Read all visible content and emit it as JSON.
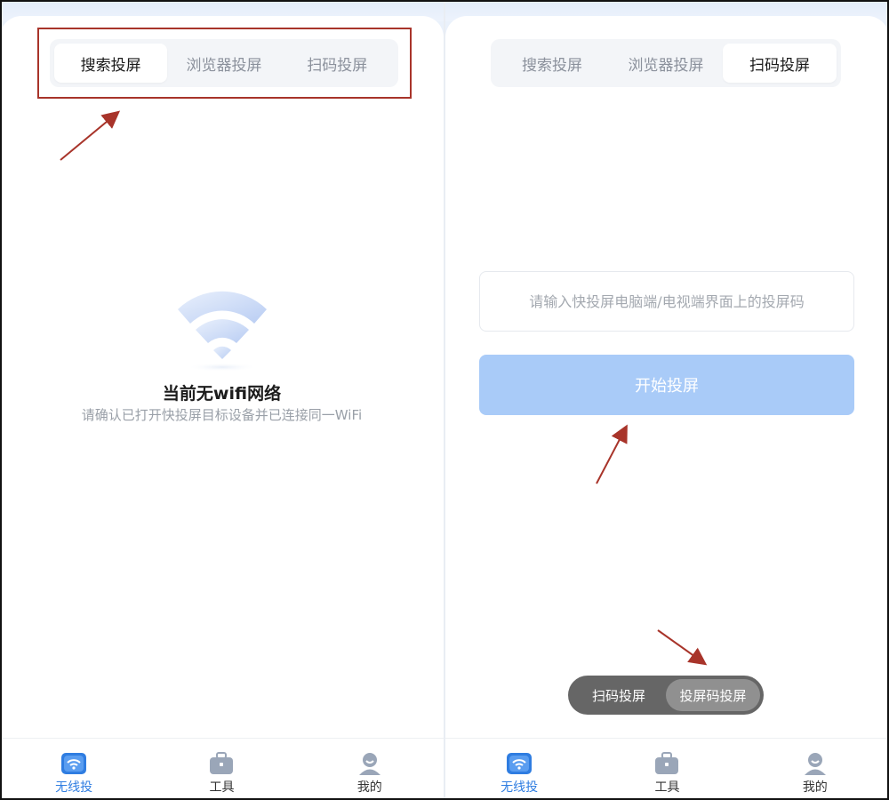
{
  "left_screen": {
    "tabs": [
      {
        "label": "搜索投屏",
        "active": true
      },
      {
        "label": "浏览器投屏",
        "active": false
      },
      {
        "label": "扫码投屏",
        "active": false
      }
    ],
    "empty_state": {
      "title": "当前无wifi网络",
      "subtitle": "请确认已打开快投屏目标设备并已连接同一WiFi",
      "icon": "wifi-icon"
    }
  },
  "right_screen": {
    "tabs": [
      {
        "label": "搜索投屏",
        "active": false
      },
      {
        "label": "浏览器投屏",
        "active": false
      },
      {
        "label": "扫码投屏",
        "active": true
      }
    ],
    "code_input": {
      "placeholder": "请输入快投屏电脑端/电视端界面上的投屏码",
      "value": ""
    },
    "start_button": "开始投屏",
    "mode_toggle": {
      "options": [
        {
          "label": "扫码投屏",
          "active": false
        },
        {
          "label": "投屏码投屏",
          "active": true
        }
      ]
    }
  },
  "bottom_nav": [
    {
      "label": "无线投",
      "icon": "wireless-cast-icon",
      "active": true
    },
    {
      "label": "工具",
      "icon": "toolbox-icon",
      "active": false
    },
    {
      "label": "我的",
      "icon": "profile-icon",
      "active": false
    }
  ],
  "colors": {
    "accent": "#2f7de1",
    "button_disabled": "#a9cbf8",
    "annotation": "#a8342a"
  }
}
